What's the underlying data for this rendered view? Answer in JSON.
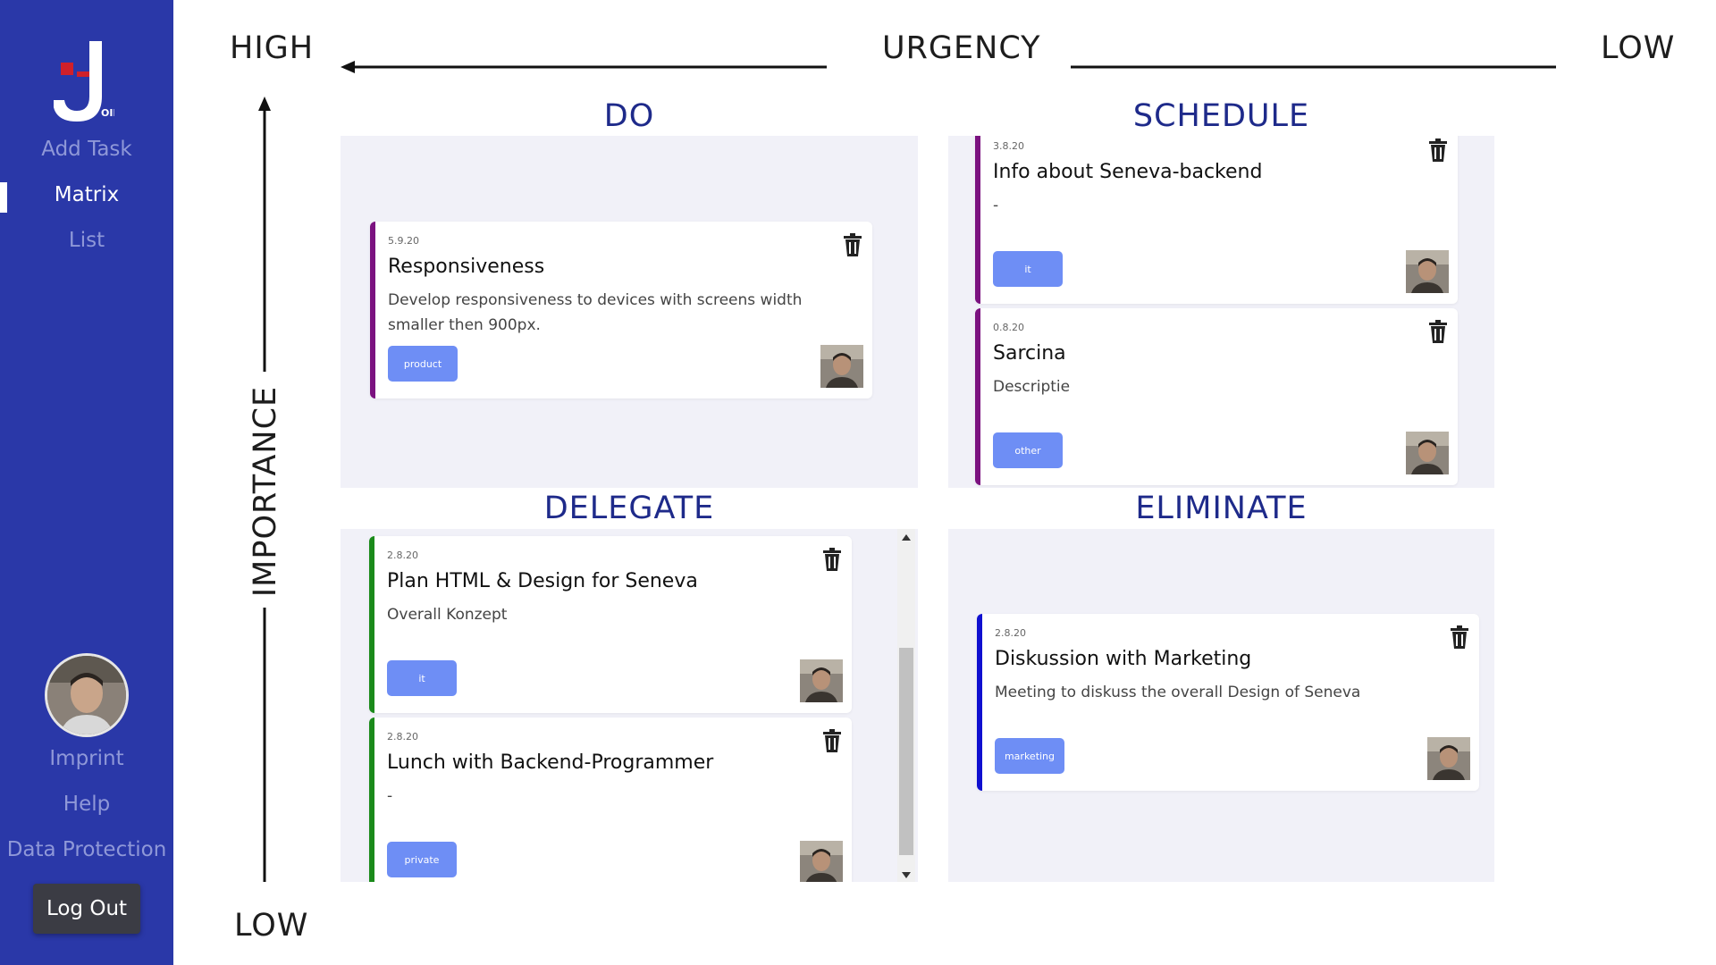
{
  "sidebar": {
    "logo_text": "OIN",
    "nav": [
      {
        "label": "Add Task",
        "active": false
      },
      {
        "label": "Matrix",
        "active": true
      },
      {
        "label": "List",
        "active": false
      }
    ],
    "footer_links": [
      "Imprint",
      "Help",
      "Data Protection"
    ],
    "logout_label": "Log Out"
  },
  "axes": {
    "urgency": "URGENCY",
    "urgency_high": "HIGH",
    "urgency_low": "LOW",
    "importance": "IMPORTANCE",
    "importance_low": "LOW"
  },
  "quadrants": {
    "do": {
      "title": "DO",
      "tasks": [
        {
          "date": "5.9.20",
          "title": "Responsiveness",
          "description": "Develop responsiveness to devices with screens width smaller then 900px.",
          "tag": "product",
          "bar_color": "#7b1280"
        }
      ]
    },
    "schedule": {
      "title": "SCHEDULE",
      "tasks": [
        {
          "date": "3.8.20",
          "title": "Info about Seneva-backend",
          "description": "-",
          "tag": "it",
          "bar_color": "#7b1280"
        },
        {
          "date": "0.8.20",
          "title": "Sarcina",
          "description": "Descriptie",
          "tag": "other",
          "bar_color": "#7b1280"
        }
      ]
    },
    "delegate": {
      "title": "DELEGATE",
      "tasks": [
        {
          "date": "2.8.20",
          "title": "Plan HTML & Design for Seneva",
          "description": "Overall Konzept",
          "tag": "it",
          "bar_color": "#1a8a1a"
        },
        {
          "date": "2.8.20",
          "title": "Lunch with Backend-Programmer",
          "description": "-",
          "tag": "private",
          "bar_color": "#1a8a1a"
        }
      ]
    },
    "eliminate": {
      "title": "ELIMINATE",
      "tasks": [
        {
          "date": "2.8.20",
          "title": "Diskussion with Marketing",
          "description": "Meeting to diskuss the overall Design of Seneva",
          "tag": "marketing",
          "bar_color": "#1010d0"
        }
      ]
    }
  },
  "colors": {
    "sidebar_bg": "#2a38a8",
    "quadrant_bg": "#f1f1f8",
    "tag_bg": "#6e8ef5",
    "title_color": "#1e2a8a"
  },
  "icons": {
    "trash": "trash-icon",
    "logo": "join-logo",
    "avatar": "user-avatar"
  }
}
